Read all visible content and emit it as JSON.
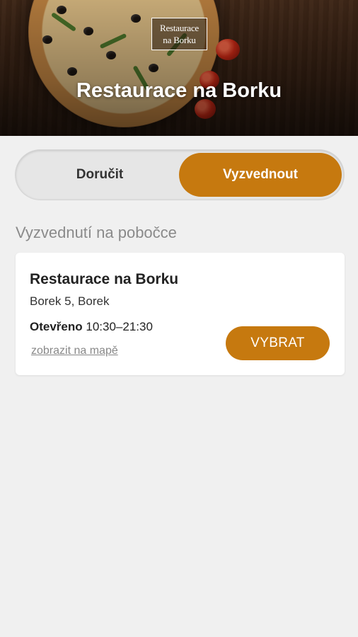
{
  "hero": {
    "logo_line1": "Restaurace",
    "logo_line2": "na Borku",
    "title": "Restaurace na Borku"
  },
  "toggle": {
    "deliver_label": "Doručit",
    "pickup_label": "Vyzvednout",
    "selected": "pickup"
  },
  "section": {
    "title": "Vyzvednutí na pobočce"
  },
  "branch": {
    "name": "Restaurace na Borku",
    "address": "Borek 5, Borek",
    "open_label": "Otevřeno",
    "open_hours": "10:30–21:30",
    "map_link": "zobrazit na mapě",
    "select_label": "VYBRAT"
  },
  "colors": {
    "accent": "#c6790f",
    "background": "#f0f0f0"
  }
}
